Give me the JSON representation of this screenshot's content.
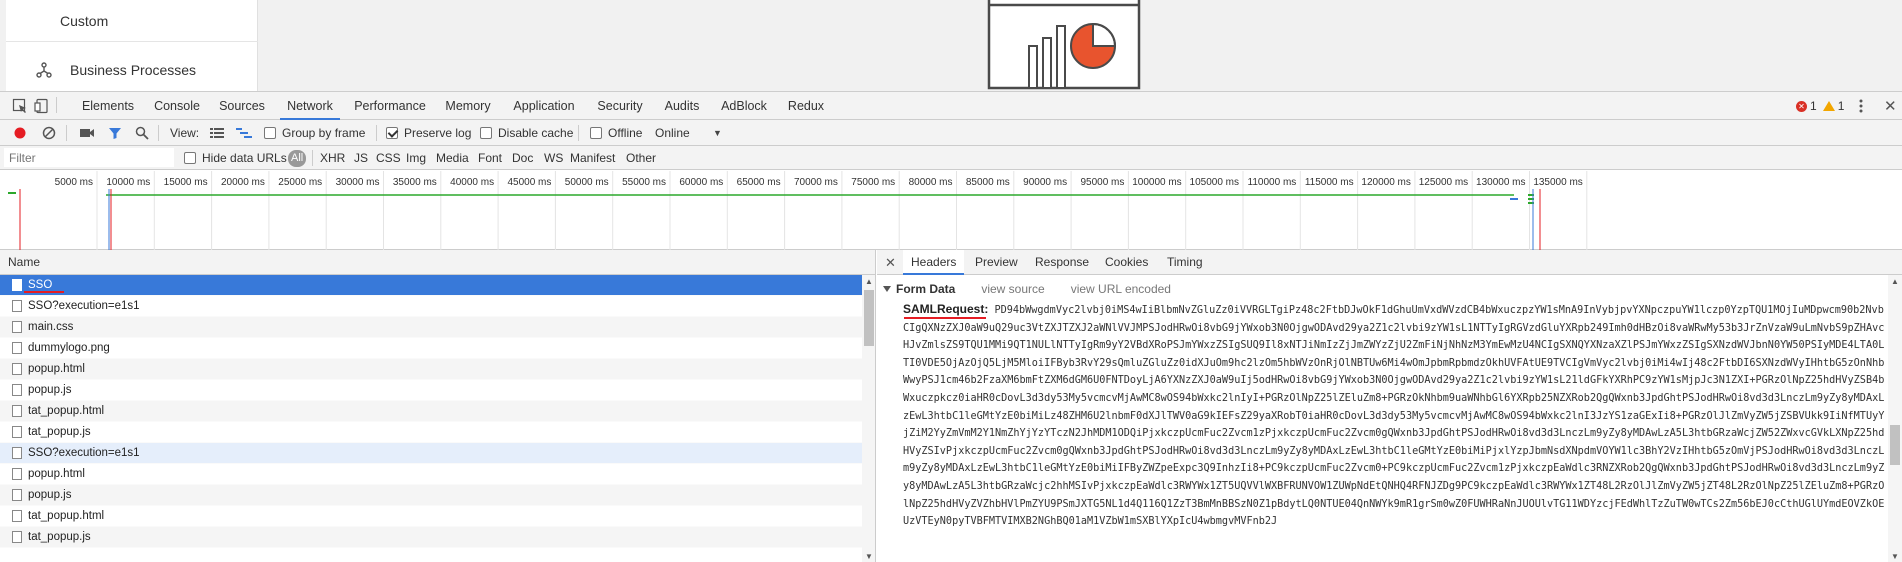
{
  "app": {
    "nav_custom": "Custom",
    "nav_business_processes": "Business Processes"
  },
  "devtools": {
    "tabs": [
      "Elements",
      "Console",
      "Sources",
      "Network",
      "Performance",
      "Memory",
      "Application",
      "Security",
      "Audits",
      "AdBlock",
      "Redux"
    ],
    "active_tab": "Network",
    "error_count": "1",
    "warning_count": "1"
  },
  "toolbar": {
    "view_label": "View:",
    "group_by_frame": "Group by frame",
    "preserve_log": "Preserve log",
    "disable_cache": "Disable cache",
    "offline": "Offline",
    "throttle_value": "Online"
  },
  "filter": {
    "placeholder": "Filter",
    "hide_data_urls": "Hide data URLs",
    "types": [
      "All",
      "XHR",
      "JS",
      "CSS",
      "Img",
      "Media",
      "Font",
      "Doc",
      "WS",
      "Manifest",
      "Other"
    ]
  },
  "timeline": {
    "ticks": [
      "5000 ms",
      "10000 ms",
      "15000 ms",
      "20000 ms",
      "25000 ms",
      "30000 ms",
      "35000 ms",
      "40000 ms",
      "45000 ms",
      "50000 ms",
      "55000 ms",
      "60000 ms",
      "65000 ms",
      "70000 ms",
      "75000 ms",
      "80000 ms",
      "85000 ms",
      "90000 ms",
      "95000 ms",
      "100000 ms",
      "105000 ms",
      "110000 ms",
      "115000 ms",
      "120000 ms",
      "125000 ms",
      "130000 ms",
      "135000 ms"
    ]
  },
  "requests": {
    "column_name": "Name",
    "rows": [
      {
        "name": "SSO",
        "state": "selected"
      },
      {
        "name": "SSO?execution=e1s1",
        "state": "normal"
      },
      {
        "name": "main.css",
        "state": "alt"
      },
      {
        "name": "dummylogo.png",
        "state": "normal"
      },
      {
        "name": "popup.html",
        "state": "alt"
      },
      {
        "name": "popup.js",
        "state": "normal"
      },
      {
        "name": "tat_popup.html",
        "state": "alt"
      },
      {
        "name": "tat_popup.js",
        "state": "normal"
      },
      {
        "name": "SSO?execution=e1s1",
        "state": "hl"
      },
      {
        "name": "popup.html",
        "state": "normal"
      },
      {
        "name": "popup.js",
        "state": "alt"
      },
      {
        "name": "tat_popup.html",
        "state": "normal"
      },
      {
        "name": "tat_popup.js",
        "state": "alt"
      }
    ]
  },
  "detail": {
    "tabs": [
      "Headers",
      "Preview",
      "Response",
      "Cookies",
      "Timing"
    ],
    "active_tab": "Headers",
    "form_data_title": "Form Data",
    "view_source": "view source",
    "view_url_encoded": "view URL encoded",
    "saml_label": "SAMLRequest:",
    "saml_value": "PD94bWwgdmVyc2lvbj0iMS4wIiBlbmNvZGluZz0iVVRGLTgiPz48c2FtbDJwOkF1dGhuUmVxdWVzdCB4bWxuczpzYW1sMnA9InVybjpvYXNpczpuYW1lczp0YzpTQU1MOjIuMDpwcm90b2NvbCIgQXNzZXJ0aW9uQ29uc3VtZXJTZXJ2aWNlVVJMPSJodHRwOi8vbG9jYWxob3N0OjgwODAvd29ya2Z1c2lvbi9zYW1sL1NTTyIgRGVzdGluYXRpb249Imh0dHBzOi8vaWRwMy53b3JrZnVzaW9uLmNvbS9pZHAvcHJvZmlsZS9TQU1MMi9QT1NULlNTTyIgRm9yY2VBdXRoPSJmYWxzZSIgSUQ9Il8xNTJiNmIzZjJmZWYzZjU2ZmFiNjNhNzM3YmEwMzU4NCIgSXNQYXNzaXZlPSJmYWxzZSIgSXNzdWVJbnN0YW50PSIyMDE4LTA0LTI0VDE5OjAzOjQ5LjM5MloiIFByb3RvY29sQmluZGluZz0idXJuOm9hc2lzOm5hbWVzOnRjOlNBTUw6Mi4wOmJpbmRpbmdzOkhUVFAtUE9TVCIgVmVyc2lvbj0iMi4wIj48c2FtbDI6SXNzdWVyIHhtbG5zOnNhbWwyPSJ1cm46b2FzaXM6bmFtZXM6dGM6U0FNTDoyLjA6YXNzZXJ0aW9uIj5odHRwOi8vbG9jYWxob3N0OjgwODAvd29ya2Z1c2lvbi9zYW1sL21ldGFkYXRhPC9zYW1sMjpJc3N1ZXI+PGRzOlNpZ25hdHVyZSB4bWxuczpkcz0iaHR0cDovL3d3dy53My5vcmcvMjAwMC8wOS94bWxkc2lnIyI+PGRzOlNpZ25lZEluZm8+PGRzOkNhbm9uaWNhbGl6YXRpb25NZXRob2QgQWxnb3JpdGhtPSJodHRwOi8vd3d3LnczLm9yZy8yMDAxLzEwL3htbC1leGMtYzE0biMiLz48ZHM6U2lnbmF0dXJlTWV0aG9kIEFsZ29yaXRobT0iaHR0cDovL3d3dy53My5vcmcvMjAwMC8wOS94bWxkc2lnI3JzYS1zaGExIi8+PGRzOlJlZmVyZW5jZSBVUkk9IiNfMTUyYjZiM2YyZmVmM2Y1NmZhYjYzYTczN2JhMDM1ODQiPjxkczpUcmFuc2Zvcm1zPjxkczpUcmFuc2Zvcm0gQWxnb3JpdGhtPSJodHRwOi8vd3d3LnczLm9yZy8yMDAwLzA5L3htbGRzaWcjZW52ZWxvcGVkLXNpZ25hdHVyZSIvPjxkczpUcmFuc2Zvcm0gQWxnb3JpdGhtPSJodHRwOi8vd3d3LnczLm9yZy8yMDAxLzEwL3htbC1leGMtYzE0biMiPjxlYzpJbmNsdXNpdmVOYW1lc3BhY2VzIHhtbG5zOmVjPSJodHRwOi8vd3d3LnczLm9yZy8yMDAxLzEwL3htbC1leGMtYzE0biMiIFByZWZpeExpc3Q9InhzIi8+PC9kczpUcmFuc2Zvcm0+PC9kczpUcmFuc2Zvcm1zPjxkczpEaWdlc3RNZXRob2QgQWxnb3JpdGhtPSJodHRwOi8vd3d3LnczLm9yZy8yMDAwLzA5L3htbGRzaWcjc2hhMSIvPjxkczpEaWdlc3RWYWx1ZT5UQVVlWXBFRUNVOW1ZUWpNdEtQNHQ4RFNJZDg9PC9kczpEaWdlc3RWYWx1ZT48L2RzOlJlZmVyZW5jZT48L2RzOlNpZ25lZEluZm8+PGRzOlNpZ25hdHVyZVZhbHVlPmZYU9PSmJXTG5NL1d4Q116Q1ZzT3BmMnBBSzN0Z1pBdytLQ0NTUE04QnNWYk9mR1grSm0wZ0FUWHRaNnJUOUlvTG11WDYzcjFEdWhlTzZuTW0wTCs2Zm56bEJ0cCthUGlUYmdEOVZkOEUzVTEyN0pyTVBFMTVIMXB2NGhBQ01aM1VZbW1mSXBlYXpIcU4wbmgvMVFnb2J"
  }
}
